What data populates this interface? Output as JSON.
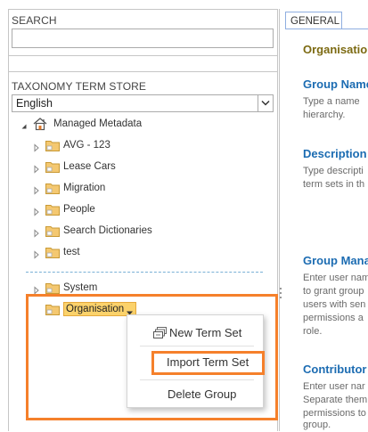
{
  "search": {
    "label": "SEARCH",
    "value": "",
    "placeholder": ""
  },
  "taxonomy": {
    "label": "TAXONOMY TERM STORE",
    "language": "English",
    "root": "Managed Metadata",
    "groups": [
      "AVG - 123",
      "Lease Cars",
      "Migration",
      "People",
      "Search Dictionaries",
      "test"
    ],
    "system": "System",
    "selected": "Organisation"
  },
  "context_menu": {
    "items": [
      "New Term Set",
      "Import Term Set",
      "Delete Group"
    ]
  },
  "properties": {
    "tab": "GENERAL",
    "title": "Organisation",
    "group_name": {
      "heading": "Group Name",
      "lines": [
        "Type a name",
        "hierarchy."
      ]
    },
    "description": {
      "heading": "Description",
      "lines": [
        "Type descripti",
        "term sets in th"
      ]
    },
    "group_managers": {
      "heading": "Group Mana",
      "lines": [
        "Enter user nam",
        "to grant group",
        "users with sen",
        "permissions a",
        "role."
      ]
    },
    "contributors": {
      "heading": "Contributor",
      "lines": [
        "Enter user nar",
        "Separate them",
        "permissions to",
        "group."
      ]
    }
  },
  "colors": {
    "accent": "#f5802b",
    "selected_fill": "#fbd26b",
    "heading_blue": "#1c6cb2",
    "title_olive": "#7c6a12"
  }
}
